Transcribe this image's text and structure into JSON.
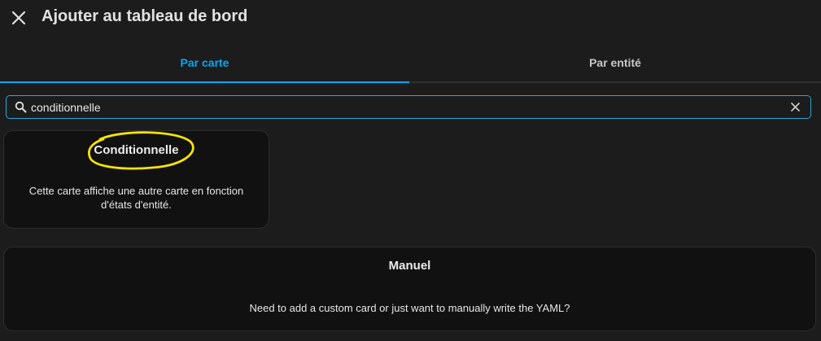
{
  "header": {
    "title": "Ajouter au tableau de bord",
    "close_icon": "close-icon"
  },
  "tabs": [
    {
      "label": "Par carte",
      "active": true
    },
    {
      "label": "Par entité",
      "active": false
    }
  ],
  "search": {
    "value": "conditionnelle",
    "search_icon": "search-icon",
    "clear_icon": "clear-icon"
  },
  "cards": [
    {
      "title": "Conditionnelle",
      "description": "Cette carte affiche une autre carte en fonction d'états d'entité.",
      "highlighted": true
    },
    {
      "title": "Manuel",
      "description": "Need to add a custom card or just want to manually write the YAML?"
    }
  ],
  "colors": {
    "accent": "#03a9f4",
    "background": "#1c1c1c",
    "card": "#111111",
    "highlight": "#f5e400"
  }
}
